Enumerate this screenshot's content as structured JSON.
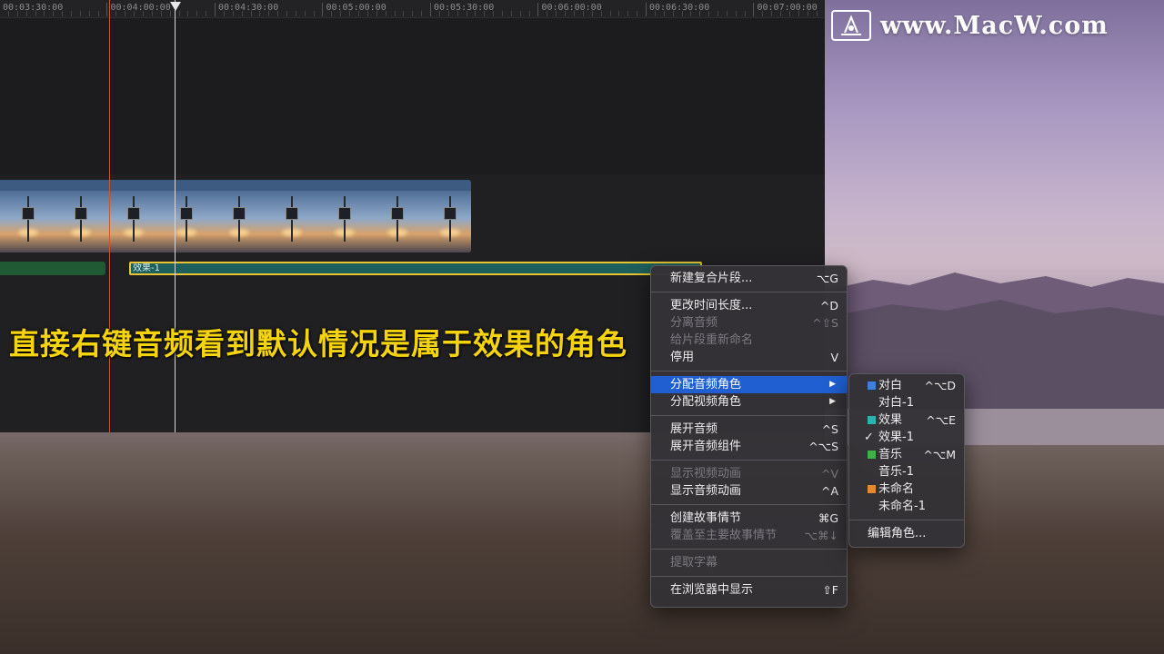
{
  "watermark": {
    "text": "www.MacW.com"
  },
  "timeline": {
    "ruler_labels": [
      "00:03:30:00",
      "00:04:00:00",
      "00:04:30:00",
      "00:05:00:00",
      "00:05:30:00",
      "00:06:00:00",
      "00:06:30:00",
      "00:07:00:00"
    ],
    "audio_clip_label": "效果-1"
  },
  "caption": "直接右键音频看到默认情况是属于效果的角色",
  "context_menu": {
    "items": [
      {
        "label": "新建复合片段...",
        "shortcut": "⌥G",
        "enabled": true
      },
      {
        "separator": true
      },
      {
        "label": "更改时间长度...",
        "shortcut": "^D",
        "enabled": true
      },
      {
        "label": "分离音频",
        "shortcut": "^⇧S",
        "enabled": false
      },
      {
        "label": "给片段重新命名",
        "shortcut": "",
        "enabled": false
      },
      {
        "label": "停用",
        "shortcut": "V",
        "enabled": true
      },
      {
        "separator": true
      },
      {
        "label": "分配音频角色",
        "shortcut": "",
        "enabled": true,
        "submenu": true,
        "highlighted": true
      },
      {
        "label": "分配视频角色",
        "shortcut": "",
        "enabled": true,
        "submenu": true
      },
      {
        "separator": true
      },
      {
        "label": "展开音频",
        "shortcut": "^S",
        "enabled": true
      },
      {
        "label": "展开音频组件",
        "shortcut": "^⌥S",
        "enabled": true
      },
      {
        "separator": true
      },
      {
        "label": "显示视频动画",
        "shortcut": "^V",
        "enabled": false
      },
      {
        "label": "显示音频动画",
        "shortcut": "^A",
        "enabled": true
      },
      {
        "separator": true
      },
      {
        "label": "创建故事情节",
        "shortcut": "⌘G",
        "enabled": true
      },
      {
        "label": "覆盖至主要故事情节",
        "shortcut": "⌥⌘↓",
        "enabled": false
      },
      {
        "separator": true
      },
      {
        "label": "提取字幕",
        "shortcut": "",
        "enabled": false
      },
      {
        "separator": true
      },
      {
        "label": "在浏览器中显示",
        "shortcut": "⇧F",
        "enabled": true
      }
    ]
  },
  "roles_submenu": {
    "items": [
      {
        "label": "对白",
        "shortcut": "^⌥D",
        "color": "#3f7fd6",
        "checked": false
      },
      {
        "label": "对白-1",
        "shortcut": "",
        "color": "",
        "checked": false
      },
      {
        "label": "效果",
        "shortcut": "^⌥E",
        "color": "#2bb3b1",
        "checked": false
      },
      {
        "label": "效果-1",
        "shortcut": "",
        "color": "",
        "checked": true
      },
      {
        "label": "音乐",
        "shortcut": "^⌥M",
        "color": "#3bb34a",
        "checked": false
      },
      {
        "label": "音乐-1",
        "shortcut": "",
        "color": "",
        "checked": false
      },
      {
        "label": "未命名",
        "shortcut": "",
        "color": "#e48a2a",
        "checked": false
      },
      {
        "label": "未命名-1",
        "shortcut": "",
        "color": "",
        "checked": false
      }
    ],
    "edit_label": "编辑角色..."
  }
}
